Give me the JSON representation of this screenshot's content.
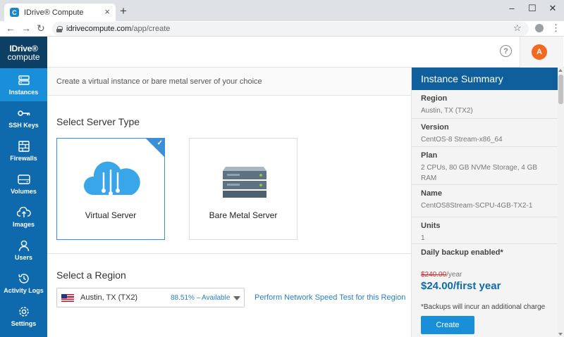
{
  "browser": {
    "tab_title": "IDrive® Compute",
    "tab_favicon": "C",
    "url_host": "idrivecompute.com",
    "url_path": "/app/create",
    "icons": [
      "back-icon",
      "forward-icon",
      "reload-icon",
      "lock-icon",
      "star-icon",
      "profile-icon",
      "menu-icon"
    ]
  },
  "sidebar": {
    "logo_top": "IDrive®",
    "logo_bottom": "compute",
    "items": [
      {
        "label": "Instances",
        "icon": "instances-icon",
        "active": true
      },
      {
        "label": "SSH Keys",
        "icon": "key-icon"
      },
      {
        "label": "Firewalls",
        "icon": "firewall-icon"
      },
      {
        "label": "Volumes",
        "icon": "volume-icon"
      },
      {
        "label": "Images",
        "icon": "cloud-upload-icon"
      },
      {
        "label": "Users",
        "icon": "user-icon"
      },
      {
        "label": "Activity Logs",
        "icon": "history-icon"
      },
      {
        "label": "Settings",
        "icon": "gear-icon"
      }
    ]
  },
  "header": {
    "help": "?",
    "avatar_initial": "A"
  },
  "main": {
    "subtitle": "Create a virtual instance or bare metal server of your choice",
    "server_type_title": "Select Server Type",
    "server_types": [
      {
        "label": "Virtual Server",
        "selected": true
      },
      {
        "label": "Bare Metal Server",
        "selected": false
      }
    ],
    "region_title": "Select a Region",
    "region": {
      "name": "Austin, TX (TX2)",
      "percent": "88.51%",
      "separator": "–",
      "status": "Available"
    },
    "speed_test_link": "Perform Network Speed Test for this Region"
  },
  "summary": {
    "title": "Instance Summary",
    "region_label": "Region",
    "region_value": "Austin, TX (TX2)",
    "version_label": "Version",
    "version_value": "CentOS-8 Stream-x86_64",
    "plan_label": "Plan",
    "plan_value": "2 CPUs, 80 GB NVMe Storage, 4 GB RAM",
    "name_label": "Name",
    "name_value": "CentOS8Stream-SCPU-4GB-TX2-1",
    "units_label": "Units",
    "units_value": "1",
    "backup_label": "Daily backup enabled*",
    "old_price": "$240.00",
    "old_price_unit": "/year",
    "new_price": "$24.00/first year",
    "note": "*Backups will incur an additional charge",
    "create_label": "Create"
  },
  "colors": {
    "sidebar": "#0f6aad",
    "sidebar_active": "#1a8fd9",
    "summary_header": "#0f5f9c",
    "link": "#2a7fc2",
    "avatar": "#f26a21",
    "price_old": "#c53030"
  }
}
